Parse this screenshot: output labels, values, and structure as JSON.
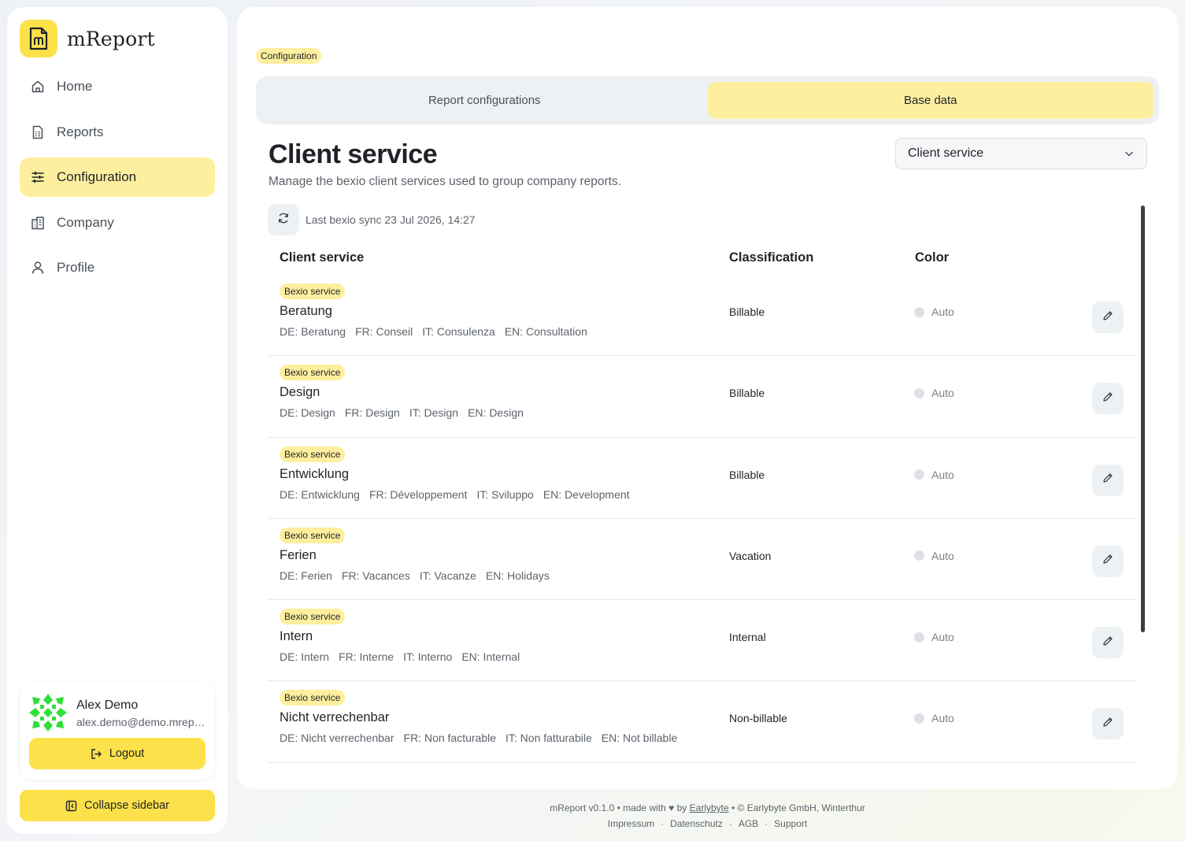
{
  "brand": {
    "name": "mReport",
    "logo_icon": "document-m-icon",
    "accent": "#fde14a"
  },
  "nav": [
    {
      "label": "Home",
      "icon": "home-icon",
      "active": false
    },
    {
      "label": "Reports",
      "icon": "report-icon",
      "active": false
    },
    {
      "label": "Configuration",
      "icon": "sliders-icon",
      "active": true
    },
    {
      "label": "Company",
      "icon": "building-icon",
      "active": false
    },
    {
      "label": "Profile",
      "icon": "user-icon",
      "active": false
    }
  ],
  "user": {
    "name": "Alex Demo",
    "email": "alex.demo@demo.mreport.ch",
    "logout_label": "Logout"
  },
  "collapse_label": "Collapse sidebar",
  "breadcrumb": "Configuration",
  "tabs": [
    {
      "label": "Report configurations",
      "active": false
    },
    {
      "label": "Base data",
      "active": true
    }
  ],
  "page": {
    "title": "Client service",
    "subtitle": "Manage the bexio client services used to group company reports.",
    "select_value": "Client service",
    "sync_text": "Last bexio sync 23 Jul 2026, 14:27"
  },
  "table": {
    "headers": {
      "service": "Client service",
      "classification": "Classification",
      "color": "Color"
    },
    "rows": [
      {
        "badge": "Bexio service",
        "name": "Beratung",
        "de": "DE: Beratung",
        "fr": "FR: Conseil",
        "it": "IT: Consulenza",
        "en": "EN: Consultation",
        "classification": "Billable",
        "color": "Auto"
      },
      {
        "badge": "Bexio service",
        "name": "Design",
        "de": "DE: Design",
        "fr": "FR: Design",
        "it": "IT: Design",
        "en": "EN: Design",
        "classification": "Billable",
        "color": "Auto"
      },
      {
        "badge": "Bexio service",
        "name": "Entwicklung",
        "de": "DE: Entwicklung",
        "fr": "FR: Développement",
        "it": "IT: Sviluppo",
        "en": "EN: Development",
        "classification": "Billable",
        "color": "Auto"
      },
      {
        "badge": "Bexio service",
        "name": "Ferien",
        "de": "DE: Ferien",
        "fr": "FR: Vacances",
        "it": "IT: Vacanze",
        "en": "EN: Holidays",
        "classification": "Vacation",
        "color": "Auto"
      },
      {
        "badge": "Bexio service",
        "name": "Intern",
        "de": "DE: Intern",
        "fr": "FR: Interne",
        "it": "IT: Interno",
        "en": "EN: Internal",
        "classification": "Internal",
        "color": "Auto"
      },
      {
        "badge": "Bexio service",
        "name": "Nicht verrechenbar",
        "de": "DE: Nicht verrechenbar",
        "fr": "FR: Non facturable",
        "it": "IT: Non fatturabile",
        "en": "EN: Not billable",
        "classification": "Non-billable",
        "color": "Auto"
      }
    ]
  },
  "footer": {
    "line1_prefix": "mReport v0.1.0 • made with ♥ by",
    "link": "Earlybyte",
    "line1_suffix": "• © Earlybyte GmbH, Winterthur",
    "links": [
      "Impressum",
      "Datenschutz",
      "AGB",
      "Support"
    ],
    "separator": "·"
  }
}
